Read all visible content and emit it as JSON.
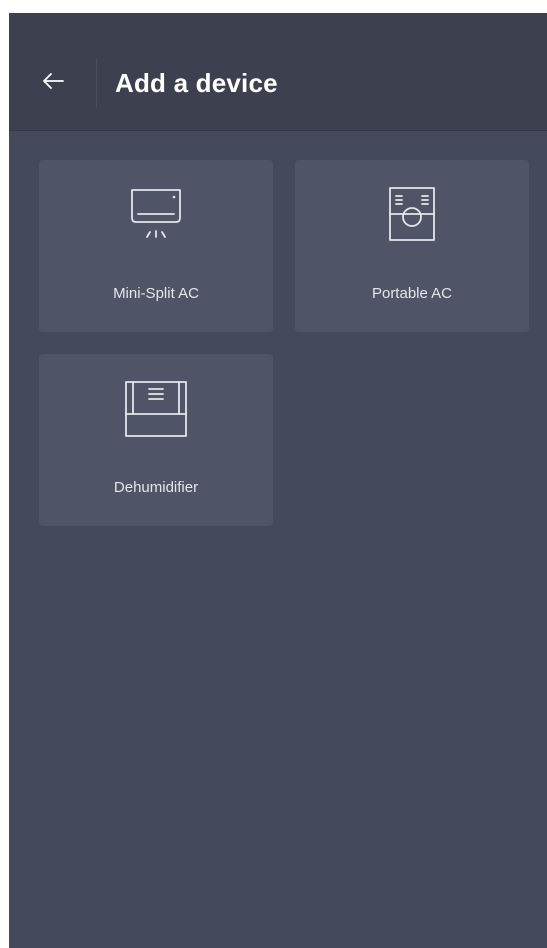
{
  "header": {
    "title": "Add a device",
    "back_icon": "arrow-left-icon"
  },
  "devices": [
    {
      "label": "Mini-Split AC",
      "icon": "mini-split-ac-icon"
    },
    {
      "label": "Portable AC",
      "icon": "portable-ac-icon"
    },
    {
      "label": "Dehumidifier",
      "icon": "dehumidifier-icon"
    }
  ],
  "colors": {
    "background": "#454a5b",
    "header": "#3c404f",
    "card": "#4f5467",
    "text": "#ffffff"
  }
}
